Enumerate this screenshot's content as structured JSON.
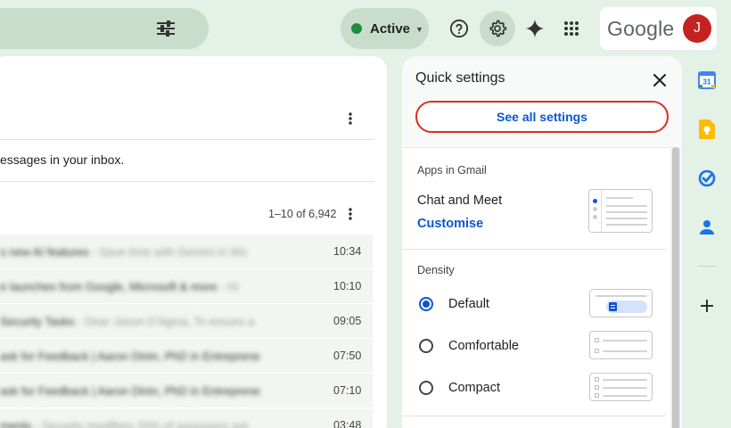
{
  "header": {
    "status": {
      "label": "Active",
      "color": "#1e8e3e"
    },
    "icons": [
      "search-options-icon",
      "help-icon",
      "settings-icon",
      "gemini-icon",
      "apps-icon"
    ],
    "account": {
      "brand": "Google",
      "avatar_initial": "J"
    }
  },
  "inbox": {
    "info_text": "essages in your inbox.",
    "pager_text": "1–10 of 6,942",
    "rows": [
      {
        "text": "s new AI features",
        "snippet": " - Save time with Gemini in Wo",
        "time": "10:34"
      },
      {
        "text": "e launches from Google, Microsoft & more",
        "snippet": " - Hi",
        "time": "10:10"
      },
      {
        "text": "Security Tasks",
        "snippet": " - Dear Jason D'Agina, To ensure a",
        "time": "09:05"
      },
      {
        "text": "ask for Feedback | Aaron Dinin, PhD in Entreprene",
        "snippet": "",
        "time": "07:50"
      },
      {
        "text": "ask for Feedback | Aaron Dinin, PhD in Entreprene",
        "snippet": "",
        "time": "07:10"
      },
      {
        "text": "ments",
        "snippet": " - Security modifiers 20% of assessors are",
        "time": "03:48"
      }
    ]
  },
  "quick_settings": {
    "title": "Quick settings",
    "see_all_label": "See all settings",
    "apps_section_title": "Apps in Gmail",
    "chat_meet_label": "Chat and Meet",
    "customise_label": "Customise",
    "density_section_title": "Density",
    "density_options": [
      {
        "label": "Default",
        "selected": true
      },
      {
        "label": "Comfortable",
        "selected": false
      },
      {
        "label": "Compact",
        "selected": false
      }
    ]
  },
  "side_apps": [
    "calendar-icon",
    "keep-icon",
    "tasks-icon",
    "contacts-icon",
    "add-icon"
  ],
  "calendar_date": "31",
  "colors": {
    "accent_blue": "#0b57d0",
    "highlight_red": "#d93025",
    "background": "#e3f1e6"
  }
}
